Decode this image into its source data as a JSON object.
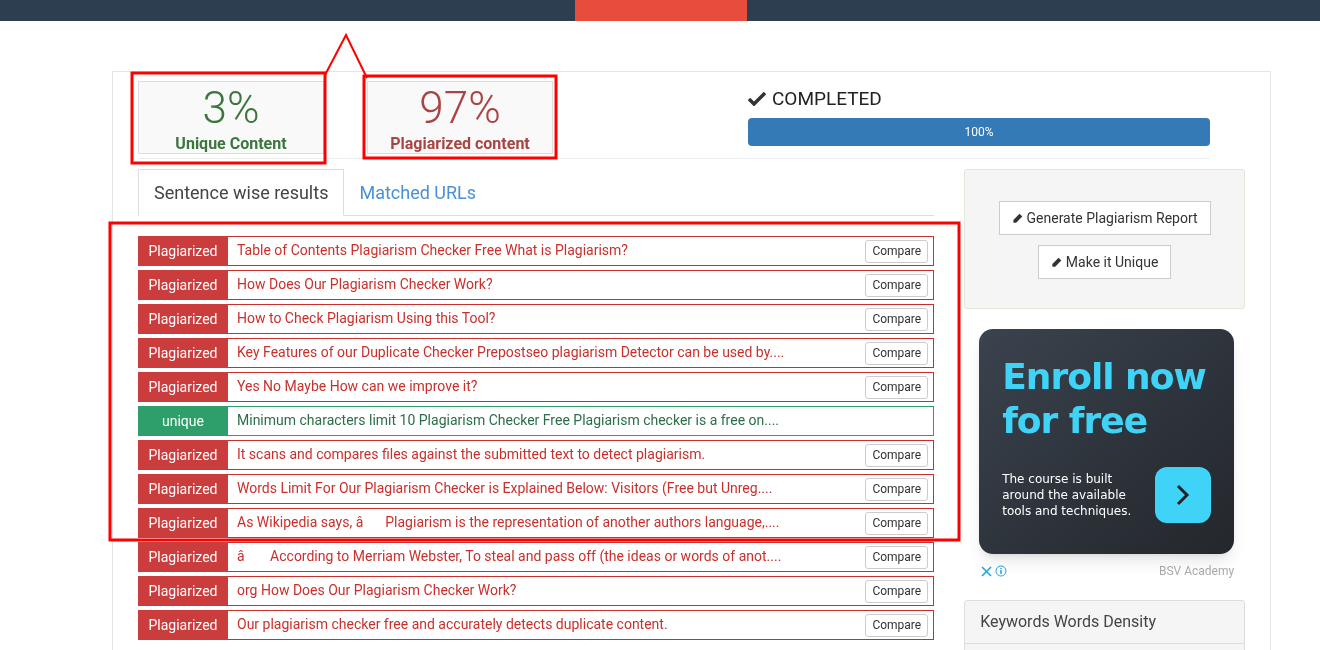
{
  "stats": [
    {
      "kind": "unique",
      "value": "3%",
      "label": "Unique Content"
    },
    {
      "kind": "plagiarized",
      "value": "97%",
      "label": "Plagiarized content"
    }
  ],
  "status": {
    "text": "COMPLETED",
    "level": 1,
    "reading": "100%"
  },
  "tabs": [
    {
      "label": "Sentence wise results",
      "selected": true
    },
    {
      "label": "Matched URLs",
      "selected": false
    }
  ],
  "results": [
    {
      "kind": "plagiarized",
      "badge": "Plagiarized",
      "text": "Table of Contents Plagiarism Checker Free What is Plagiarism?",
      "button": "Compare"
    },
    {
      "kind": "plagiarized",
      "badge": "Plagiarized",
      "text": "How Does Our Plagiarism Checker Work?",
      "button": "Compare"
    },
    {
      "kind": "plagiarized",
      "badge": "Plagiarized",
      "text": "How to Check Plagiarism Using this Tool?",
      "button": "Compare"
    },
    {
      "kind": "plagiarized",
      "badge": "Plagiarized",
      "text": "Key Features of our Duplicate Checker Prepostseo plagiarism Detector can be used by....",
      "button": "Compare"
    },
    {
      "kind": "plagiarized",
      "badge": "Plagiarized",
      "text": "Yes No Maybe How can we improve it?",
      "button": "Compare"
    },
    {
      "kind": "unique",
      "badge": "unique",
      "text": "Minimum characters limit 10 Plagiarism Checker Free Plagiarism checker is a free on...."
    },
    {
      "kind": "plagiarized",
      "badge": "Plagiarized",
      "text": "It scans and compares files against the submitted text to detect plagiarism.",
      "button": "Compare"
    },
    {
      "kind": "plagiarized",
      "badge": "Plagiarized",
      "text": "Words Limit For Our Plagiarism Checker is Explained Below: Visitors (Free but Unreg....",
      "button": "Compare"
    },
    {
      "kind": "plagiarized",
      "badge": "Plagiarized",
      "text": "As Wikipedia says, âPlagiarism is the representation of another authors language,....",
      "button": "Compare"
    },
    {
      "kind": "plagiarized",
      "badge": "Plagiarized",
      "text": "â According to Merriam Webster, To steal and pass off (the ideas or words of anot....",
      "button": "Compare"
    },
    {
      "kind": "plagiarized",
      "badge": "Plagiarized",
      "text": "org How Does Our Plagiarism Checker Work?",
      "button": "Compare"
    },
    {
      "kind": "plagiarized",
      "badge": "Plagiarized",
      "text": "Our plagiarism checker free and accurately detects duplicate content.",
      "button": "Compare"
    }
  ],
  "actions": [
    "Generate Plagiarism Report",
    "Make it Unique"
  ],
  "ad": {
    "headline": "Enroll now for free",
    "body": "The course is built around the available tools and techniques.",
    "advertiser": "BSV Academy"
  },
  "keywords_panel": {
    "title": "Keywords Words Density"
  }
}
